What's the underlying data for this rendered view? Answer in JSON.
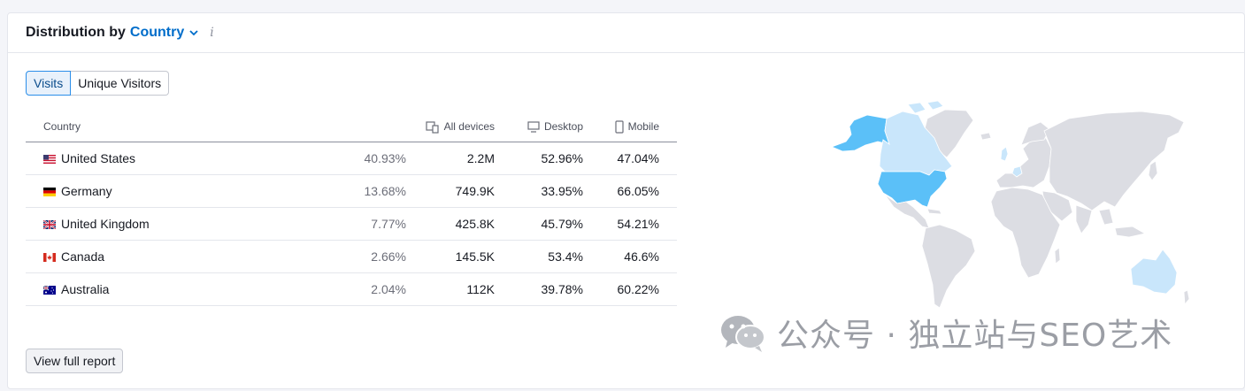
{
  "header": {
    "title": "Distribution by",
    "dimension": "Country",
    "info_glyph": "i"
  },
  "toggle": {
    "visits_label": "Visits",
    "unique_label": "Unique Visitors"
  },
  "table": {
    "headers": {
      "country": "Country",
      "all_devices": "All devices",
      "desktop": "Desktop",
      "mobile": "Mobile"
    },
    "rows": [
      {
        "flag": "us-flag",
        "country": "United States",
        "share": "40.93%",
        "visits": "2.2M",
        "desktop": "52.96%",
        "mobile": "47.04%"
      },
      {
        "flag": "de-flag",
        "country": "Germany",
        "share": "13.68%",
        "visits": "749.9K",
        "desktop": "33.95%",
        "mobile": "66.05%"
      },
      {
        "flag": "uk-flag",
        "country": "United Kingdom",
        "share": "7.77%",
        "visits": "425.8K",
        "desktop": "45.79%",
        "mobile": "54.21%"
      },
      {
        "flag": "ca-flag",
        "country": "Canada",
        "share": "2.66%",
        "visits": "145.5K",
        "desktop": "53.4%",
        "mobile": "46.6%"
      },
      {
        "flag": "au-flag",
        "country": "Australia",
        "share": "2.04%",
        "visits": "112K",
        "desktop": "39.78%",
        "mobile": "60.22%"
      }
    ]
  },
  "footer": {
    "view_report_label": "View full report"
  },
  "map": {
    "highlight_strong": "#5bc0f8",
    "highlight_light": "#c9e6fb",
    "land_default": "#dcdde3"
  },
  "watermark": {
    "text": "公众号 · 独立站与SEO艺术"
  }
}
